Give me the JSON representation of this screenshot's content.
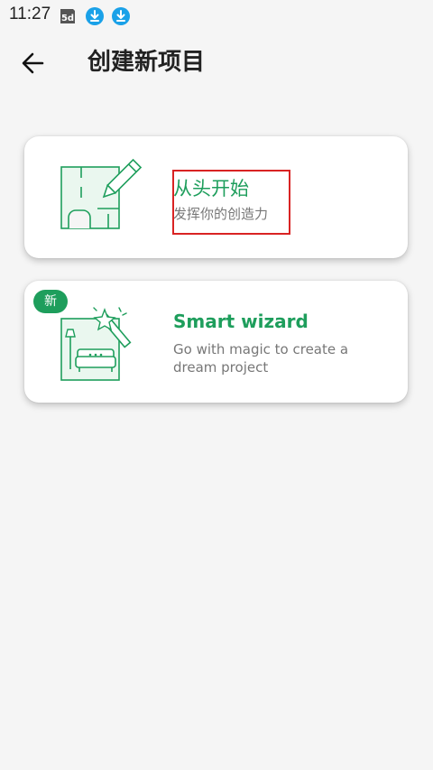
{
  "status_bar": {
    "time": "11:27",
    "icons": [
      "5d-icon",
      "download-icon",
      "download-icon"
    ]
  },
  "header": {
    "back_icon": "arrow-left-icon",
    "title": "创建新项目"
  },
  "cards": [
    {
      "title": "从头开始",
      "subtitle": "发挥你的创造力",
      "icon": "floorplan-pencil-icon"
    },
    {
      "badge": "新",
      "title": "Smart wizard",
      "subtitle": "Go with magic to create a dream project",
      "icon": "magic-wand-room-icon"
    }
  ],
  "colors": {
    "accent": "#1e9e5c",
    "background": "#f5f5f5",
    "highlight": "#d92323",
    "card": "#ffffff"
  }
}
